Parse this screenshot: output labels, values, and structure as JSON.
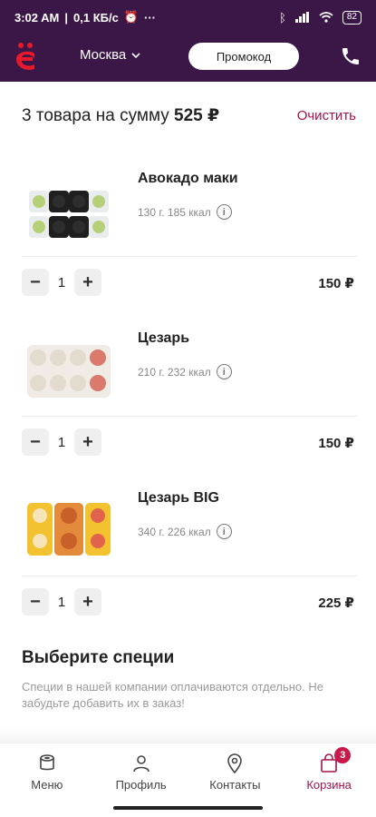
{
  "status_bar": {
    "time": "3:02 AM",
    "speed": "0,1 КБ/с",
    "battery": "82"
  },
  "header": {
    "city": "Москва",
    "promo_label": "Промокод"
  },
  "cart": {
    "summary_prefix": "3 товара на сумму",
    "summary_total": "525 ₽",
    "clear_label": "Очистить"
  },
  "items": [
    {
      "name": "Авокадо маки",
      "meta": "130 г. 185 ккал",
      "qty": "1",
      "price": "150 ₽"
    },
    {
      "name": "Цезарь",
      "meta": "210 г. 232 ккал",
      "qty": "1",
      "price": "150 ₽"
    },
    {
      "name": "Цезарь BIG",
      "meta": "340 г. 226 ккал",
      "qty": "1",
      "price": "225 ₽"
    }
  ],
  "spices": {
    "title": "Выберите специи",
    "description": "Специи в нашей компании оплачиваются отдельно. Не забудьте добавить их в заказ!"
  },
  "nav": [
    {
      "label": "Меню",
      "icon": "sushi-icon"
    },
    {
      "label": "Профиль",
      "icon": "user-icon"
    },
    {
      "label": "Контакты",
      "icon": "location-icon"
    },
    {
      "label": "Корзина",
      "icon": "bag-icon",
      "badge": "3"
    }
  ],
  "colors": {
    "brand_dark": "#3b1747",
    "accent": "#a3124f",
    "logo": "#e8192c"
  }
}
